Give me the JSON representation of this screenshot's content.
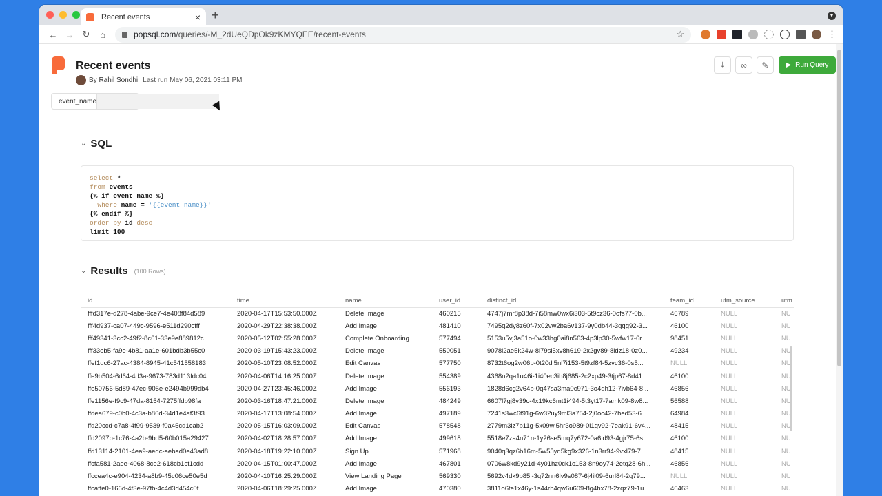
{
  "browser": {
    "tab_title": "Recent events",
    "url_host": "popsql.com",
    "url_path": "/queries/-M_2dUeQDpOk9zKMYQEE/recent-events",
    "traffic_lights": [
      "#ff5f57",
      "#febc2e",
      "#28c840"
    ]
  },
  "header": {
    "title": "Recent events",
    "author": "By Rahil Sondhi",
    "last_run": "Last run May 06, 2021 03:11 PM",
    "param_label": "event_name",
    "param_value": "",
    "run_label": "Run Query"
  },
  "sql_section": {
    "title": "SQL",
    "lines": [
      [
        {
          "t": "select",
          "c": "kw"
        },
        {
          "t": " *",
          "c": "bold"
        }
      ],
      [
        {
          "t": "from",
          "c": "kw"
        },
        {
          "t": " events",
          "c": "bold"
        }
      ],
      [
        {
          "t": "{% if event_name %}",
          "c": "bold"
        }
      ],
      [
        {
          "t": "  where",
          "c": "kw"
        },
        {
          "t": " name = ",
          "c": "bold"
        },
        {
          "t": "'{{event_name}}'",
          "c": "str"
        }
      ],
      [
        {
          "t": "{% endif %}",
          "c": "bold"
        }
      ],
      [
        {
          "t": "order by",
          "c": "kw"
        },
        {
          "t": " id ",
          "c": "bold"
        },
        {
          "t": "desc",
          "c": "kw"
        }
      ],
      [
        {
          "t": "limit 100",
          "c": "bold"
        }
      ]
    ]
  },
  "results": {
    "title": "Results",
    "count": "(100 Rows)",
    "columns": [
      "id",
      "time",
      "name",
      "user_id",
      "distinct_id",
      "team_id",
      "utm_source",
      "utm"
    ],
    "rows": [
      [
        "fffd317e-d278-4abe-9ce7-4e408f84d589",
        "2020-04-17T15:53:50.000Z",
        "Delete Image",
        "460215",
        "4747j7mr8p38d-7i58mw0wx6i303-5t9cz36-0ofs77-0b...",
        "46789",
        "NULL",
        "NU"
      ],
      [
        "fff4d937-ca07-449c-9596-e511d290cfff",
        "2020-04-29T22:38:38.000Z",
        "Add Image",
        "481410",
        "7495q2dy8z60f-7x02vw2ba6v137-9y0db44-3qqg92-3...",
        "46100",
        "NULL",
        "NU"
      ],
      [
        "fff49341-3cc2-49f2-8c61-33e9e889812c",
        "2020-05-12T02:55:28.000Z",
        "Complete Onboarding",
        "577494",
        "5153u5vj3a51o-0w33hg0ai8n563-4p3lp30-5wfw17-6r...",
        "98451",
        "NULL",
        "NU"
      ],
      [
        "fff33eb5-fa9e-4b81-aa1e-601bdb3b55c0",
        "2020-03-19T15:43:23.000Z",
        "Delete Image",
        "550051",
        "9078l2ae5k24w-8l79sl5xv8h619-2x2gv89-8ldz18-0z0...",
        "49234",
        "NULL",
        "NU"
      ],
      [
        "ffef1dc6-27ac-4384-8945-41c541558183",
        "2020-05-10T23:08:52.000Z",
        "Edit Canvas",
        "577750",
        "8732t6og2w06p-0t20dl5nl7i153-5t9zf84-5zvc36-0s5...",
        "NULL",
        "NULL",
        "NU"
      ],
      [
        "ffe9b504-6d64-4d3a-9673-783d113fdc04",
        "2020-04-06T14:16:25.000Z",
        "Delete Image",
        "554389",
        "4368n2qa1u46i-1i40ec3ih8j685-2c2xp49-3tjp67-8d41...",
        "46100",
        "NULL",
        "NU"
      ],
      [
        "ffe50756-5d89-47ec-905e-e2494b999db4",
        "2020-04-27T23:45:46.000Z",
        "Add Image",
        "556193",
        "1828d6cg2v64b-0q47sa3ma0c971-3o4dh12-7ivb64-8...",
        "46856",
        "NULL",
        "NU"
      ],
      [
        "ffe1156e-f9c9-47da-8154-7275ffdb98fa",
        "2020-03-16T18:47:21.000Z",
        "Delete Image",
        "484249",
        "6607l7gj8v39c-4x19kc6mt1i494-5t3yt17-7amk09-8w8...",
        "56588",
        "NULL",
        "NU"
      ],
      [
        "ffdea679-c0b0-4c3a-b86d-34d1e4af3f93",
        "2020-04-17T13:08:54.000Z",
        "Add Image",
        "497189",
        "7241s3wc6t91g-6w32uy9ml3a754-2j0oc42-7hed53-6...",
        "64984",
        "NULL",
        "NU"
      ],
      [
        "ffd20ccd-c7a8-4f99-9539-f0a45cd1cab2",
        "2020-05-15T16:03:09.000Z",
        "Edit Canvas",
        "578548",
        "2779m3iz7b11g-5x09wi5hr3o989-0l1qv92-7eak91-6v4...",
        "48415",
        "NULL",
        "NU"
      ],
      [
        "ffd2097b-1c76-4a2b-9bd5-60b015a29427",
        "2020-04-02T18:28:57.000Z",
        "Add Image",
        "499618",
        "5518e7za4n71n-1y26se5mq7y672-0a6id93-4gjr75-6s...",
        "46100",
        "NULL",
        "NU"
      ],
      [
        "ffd13114-2101-4ea9-aedc-aebad0e43ad8",
        "2020-04-18T19:22:10.000Z",
        "Sign Up",
        "571968",
        "9040q3qz6b16m-5w55yd5kg9x326-1n3rr94-9vxl79-7...",
        "48415",
        "NULL",
        "NU"
      ],
      [
        "ffcfa581-2aee-4068-8ce2-618cb1cf1cdd",
        "2020-04-15T01:00:47.000Z",
        "Add Image",
        "467801",
        "0706w8kd9y21d-4y01hz0ck1c153-8n9oy74-2etq28-6h...",
        "46856",
        "NULL",
        "NU"
      ],
      [
        "ffccea4c-e904-4234-a8b9-45c06ce50e5d",
        "2020-04-10T16:25:29.000Z",
        "View Landing Page",
        "569330",
        "5692v4dk9p85i-3q72nn6lv9s087-6j4il09-6url84-2q79...",
        "NULL",
        "NULL",
        "NU"
      ],
      [
        "ffcaffe0-166d-4f3e-97fb-4c4d3d454c0f",
        "2020-04-06T18:29:25.000Z",
        "Add Image",
        "470380",
        "3811o6te1x46y-1s44rh4qw6u609-8g4hx78-2zqz79-1u...",
        "46463",
        "NULL",
        "NU"
      ]
    ]
  }
}
